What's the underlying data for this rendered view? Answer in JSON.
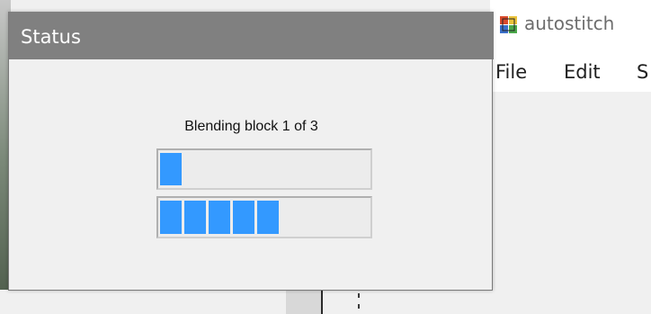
{
  "background_app": {
    "title": "autostitch",
    "menu": [
      "File",
      "Edit",
      "S"
    ]
  },
  "status_dialog": {
    "title": "Status",
    "message": "Blending block 1 of 3",
    "progress_primary": 0.11,
    "progress_secondary": 0.56,
    "bar_color": "#3399ff"
  },
  "colors": {
    "titlebar": "#808080",
    "dialog_bg": "#f0f0f0"
  }
}
